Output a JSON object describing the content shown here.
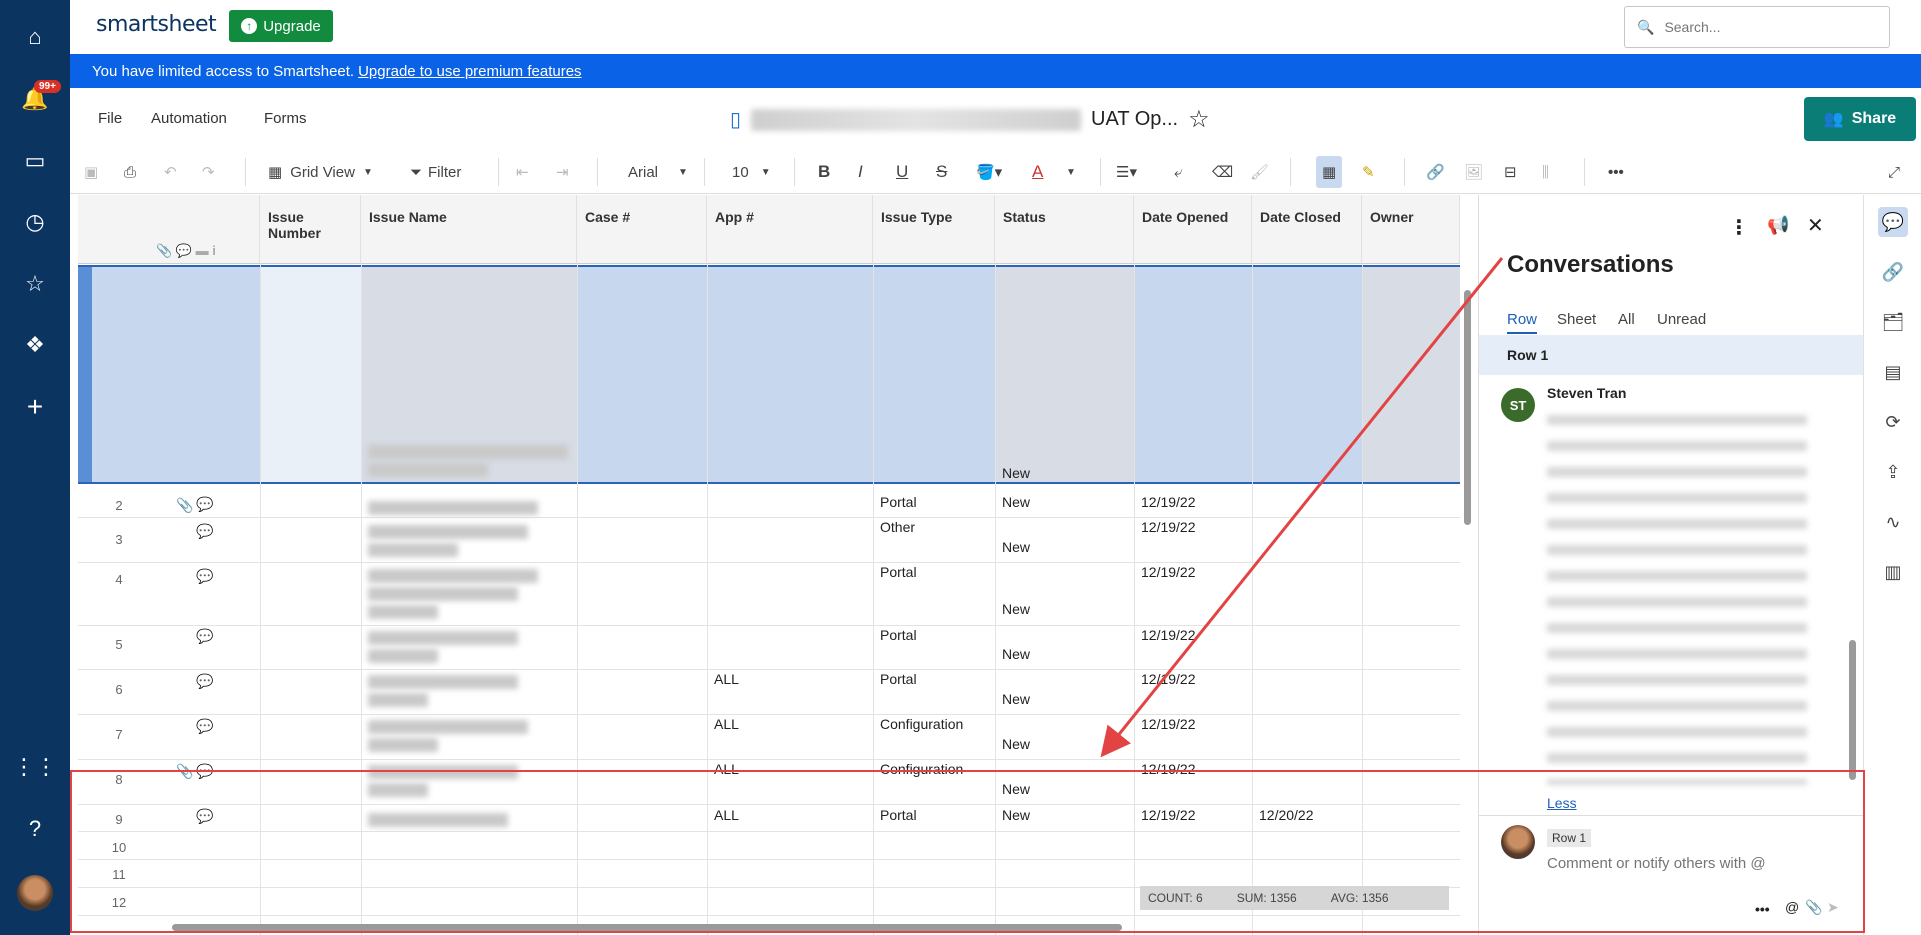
{
  "app": {
    "logo_text": "smartsheet",
    "upgrade_label": "Upgrade",
    "search_placeholder": "Search...",
    "notif_badge": "99+"
  },
  "banner": {
    "text": "You have limited access to Smartsheet.",
    "link": "Upgrade to use premium features"
  },
  "menu": {
    "file": "File",
    "automation": "Automation",
    "forms": "Forms"
  },
  "sheet": {
    "title_visible": "UAT Op...",
    "share_label": "Share"
  },
  "toolbar": {
    "grid_view": "Grid View",
    "filter": "Filter",
    "font": "Arial",
    "size": "10"
  },
  "columns": [
    "Issue Number",
    "Issue Name",
    "Case #",
    "App #",
    "Issue Type",
    "Status",
    "Date Opened",
    "Date Closed",
    "Owner"
  ],
  "rows": [
    {
      "num": "2",
      "app": "",
      "type": "Portal",
      "status": "New",
      "opened": "12/19/22",
      "closed": ""
    },
    {
      "num": "3",
      "app": "",
      "type": "Other",
      "status": "New",
      "opened": "12/19/22",
      "closed": ""
    },
    {
      "num": "4",
      "app": "",
      "type": "Portal",
      "status": "New",
      "opened": "12/19/22",
      "closed": ""
    },
    {
      "num": "5",
      "app": "",
      "type": "Portal",
      "status": "New",
      "opened": "12/19/22",
      "closed": ""
    },
    {
      "num": "6",
      "app": "ALL",
      "type": "Portal",
      "status": "New",
      "opened": "12/19/22",
      "closed": ""
    },
    {
      "num": "7",
      "app": "ALL",
      "type": "Configuration",
      "status": "New",
      "opened": "12/19/22",
      "closed": ""
    },
    {
      "num": "8",
      "app": "ALL",
      "type": "Configuration",
      "status": "New",
      "opened": "12/19/22",
      "closed": ""
    },
    {
      "num": "9",
      "app": "ALL",
      "type": "Portal",
      "status": "New",
      "opened": "12/19/22",
      "closed": "12/20/22"
    },
    {
      "num": "10"
    },
    {
      "num": "11"
    },
    {
      "num": "12"
    }
  ],
  "row1_status": "New",
  "summary": {
    "count": "COUNT: 6",
    "sum": "SUM: 1356",
    "avg": "AVG: 1356"
  },
  "conversations": {
    "title": "Conversations",
    "tabs": [
      "Row",
      "Sheet",
      "All",
      "Unread"
    ],
    "row_label": "Row 1",
    "author_initials": "ST",
    "author": "Steven Tran",
    "less_link": "Less",
    "compose_chip": "Row 1",
    "compose_placeholder": "Comment or notify others with @"
  }
}
